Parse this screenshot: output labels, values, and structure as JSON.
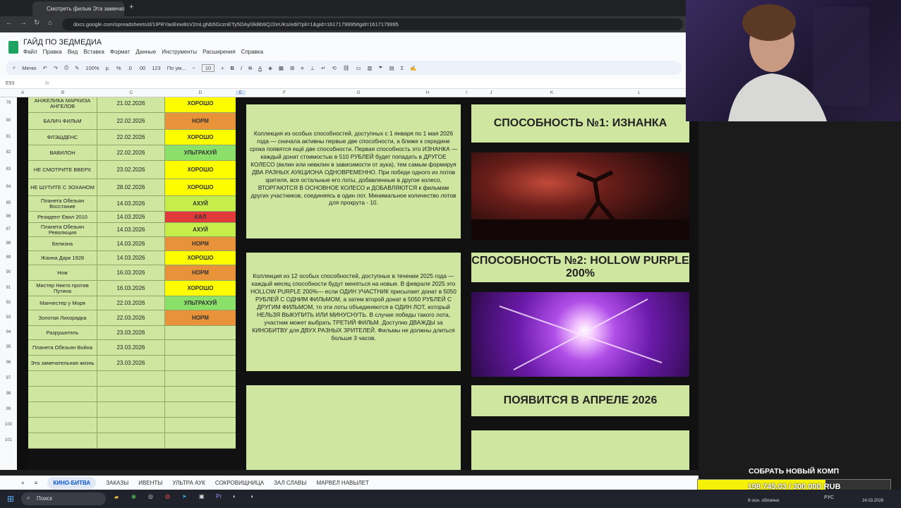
{
  "browser": {
    "tab_title": "Смотреть фильм Эта замечател...",
    "url": "docs.google.com/spreadsheets/d/1IPRYaoEew8sV2mLgNb5GcznETy5DAyl3kBb9QJ2eUKs/edit?pli=1&gid=1617179995#gid=1617179995"
  },
  "sheets": {
    "doc_title": "ГАЙД ПО ЗЕДМЕДИА",
    "menu": [
      "Файл",
      "Правка",
      "Вид",
      "Вставка",
      "Формат",
      "Данные",
      "Инструменты",
      "Расширения",
      "Справка"
    ],
    "toolbar": {
      "menu_label": "Меню",
      "zoom": "100%",
      "format_p": "р.",
      "percent": "%",
      "dec_less": ".0",
      "dec_more": ".00",
      "number_fmt": "123",
      "font": "По ум...",
      "font_size": "10"
    },
    "cell_ref": "E93",
    "fx": "fx",
    "columns": [
      "A",
      "B",
      "C",
      "D",
      "E",
      "F",
      "G",
      "H",
      "I",
      "J",
      "K",
      "L"
    ]
  },
  "rows": [
    {
      "num": "79",
      "title": "АНЖЕЛИКА МАРКИЗА АНГЕЛОВ",
      "date": "21.02.2026",
      "rating": "ХОРОШО",
      "color": "#fdfd00"
    },
    {
      "num": "80",
      "title": "БАЛИЧ ФИЛЬМ",
      "date": "22.02.2026",
      "rating": "НОРМ",
      "color": "#e8923a"
    },
    {
      "num": "81",
      "title": "ФЛЭШДЕНС",
      "date": "22.02.2026",
      "rating": "ХОРОШО",
      "color": "#fdfd00"
    },
    {
      "num": "82",
      "title": "ВАВИЛОН",
      "date": "22.02.2026",
      "rating": "УЛЬТРАХУЙ",
      "color": "#8be06a"
    },
    {
      "num": "83",
      "title": "НЕ СМОТРИТЕ ВВЕРХ",
      "date": "23.02.2026",
      "rating": "ХОРОШО",
      "color": "#fdfd00"
    },
    {
      "num": "84",
      "title": "НЕ ШУТИТЕ С ЗОХАНОМ",
      "date": "28.02.2026",
      "rating": "ХОРОШО",
      "color": "#fdfd00"
    },
    {
      "num": "85",
      "title": "Планета Обезьян Восстание",
      "date": "14.03.2026",
      "rating": "АХУЙ",
      "color": "#c5ee4a"
    },
    {
      "num": "86",
      "title": "Резидент Евил 2010",
      "date": "14.03.2026",
      "rating": "КАЛ",
      "color": "#e03a3a"
    },
    {
      "num": "87",
      "title": "Планета Обезьян Революция",
      "date": "14.03.2026",
      "rating": "АХУЙ",
      "color": "#c5ee4a"
    },
    {
      "num": "88",
      "title": "Белизна",
      "date": "14.03.2026",
      "rating": "НОРМ",
      "color": "#e8923a"
    },
    {
      "num": "89",
      "title": "Жанна Дарк 1928",
      "date": "14.03.2026",
      "rating": "ХОРОШО",
      "color": "#fdfd00"
    },
    {
      "num": "90",
      "title": "Нож",
      "date": "16.03.2026",
      "rating": "НОРМ",
      "color": "#e8923a"
    },
    {
      "num": "91",
      "title": "Мистер Никто против Путина",
      "date": "16.03.2026",
      "rating": "ХОРОШО",
      "color": "#fdfd00"
    },
    {
      "num": "92",
      "title": "Манчестер у Моря",
      "date": "22.03.2026",
      "rating": "УЛЬТРАХУЙ",
      "color": "#8be06a"
    },
    {
      "num": "93",
      "title": "Золотая Лихорадка",
      "date": "22.03.2026",
      "rating": "НОРМ",
      "color": "#e8923a"
    },
    {
      "num": "94",
      "title": "Разрушитель",
      "date": "23.03.2026",
      "rating": "",
      "color": "#cfe6a0"
    },
    {
      "num": "95",
      "title": "Планета Обезьян Война",
      "date": "23.03.2026",
      "rating": "",
      "color": "#cfe6a0"
    },
    {
      "num": "96",
      "title": "Эта замечательная жизнь",
      "date": "23.03.2026",
      "rating": "",
      "color": "#cfe6a0"
    },
    {
      "num": "97",
      "title": "",
      "date": "",
      "rating": "",
      "color": "#cfe6a0"
    },
    {
      "num": "98",
      "title": "",
      "date": "",
      "rating": "",
      "color": "#cfe6a0"
    },
    {
      "num": "99",
      "title": "",
      "date": "",
      "rating": "",
      "color": "#cfe6a0"
    },
    {
      "num": "100",
      "title": "",
      "date": "",
      "rating": "",
      "color": "#cfe6a0"
    },
    {
      "num": "101",
      "title": "",
      "date": "",
      "rating": "",
      "color": "#cfe6a0"
    }
  ],
  "panels": {
    "p1_text": "Коллекция из особых способностей, доступных с 1 января по 1 мая 2026 года — сначала активны первые две способности, а ближе к середине срока появятся ещё две способности. Первая способность это ИЗНАНКА — каждый донат стоимостью в 510 РУБЛЕЙ будет попадать в ДРУГОЕ КОЛЕСО (вклин или невклин в зависимости от аука), тем самым формируя ДВА РАЗНЫХ АУКЦИОНА ОДНОВРЕМЕННО. При победе одного из лотов зрителя, все остальные его лоты, добавленные в другое колесо, ВТОРГАЮТСЯ В ОСНОВНОЕ КОЛЕСО и ДОБАВЛЯЮТСЯ к фильмам других участников, соединяясь в один лот. Минимальное количество лотов для прокрута - 10.",
    "p1_title": "СПОСОБНОСТЬ №1: ИЗНАНКА",
    "p2_text": "Коллекция из 12 особых способностей, доступных в течении 2025 года — каждый месяц способности будут меняться на новые. В феврале 2025 это HOLLOW PURPLE 200%— если ОДИН УЧАСТНИК присылает донат в 5050 РУБЛЕЙ С ОДНИМ ФИЛЬМОМ, а затем второй донат в 5050 РУБЛЕЙ С ДРУГИМ ФИЛЬМОМ, то эти лоты объединяются в ОДИН ЛОТ, который НЕЛЬЗЯ ВЫКУПИТЬ ИЛИ МИНУСНУТЬ. В случае победы такого лота, участник может выбрать ТРЕТИЙ ФИЛЬМ. Доступно ДВАЖДЫ за КИНОБИТВУ для ДВУХ РАЗНЫХ ЗРИТЕЛЕЙ. Фильмы не должны длиться больше 3 часов.",
    "p2_title": "СПОСОБНОСТЬ №2: HOLLOW PURPLE 200%",
    "p3_title": "ПОЯВИТСЯ В АПРЕЛЕ 2026"
  },
  "sheet_tabs": [
    "КИНО-БИТВА",
    "ЗАКАЗЫ",
    "ИВЕНТЫ",
    "УЛЬТРА АУК",
    "СОКРОВИЩНИЦА",
    "ЗАЛ СЛАВЫ",
    "МАРВЕЛ НАВЫЛЕТ"
  ],
  "overlay": {
    "donate_label": "СОБРАТЬ НОВЫЙ КОМП",
    "donate_amount": "198 745.03 / 300 000",
    "donate_currency": "RUB",
    "progress": 0.6625
  },
  "taskbar": {
    "search": "Поиск",
    "weather": "8 осн. облачно",
    "lang": "РУС",
    "date": "24.03.2026"
  }
}
